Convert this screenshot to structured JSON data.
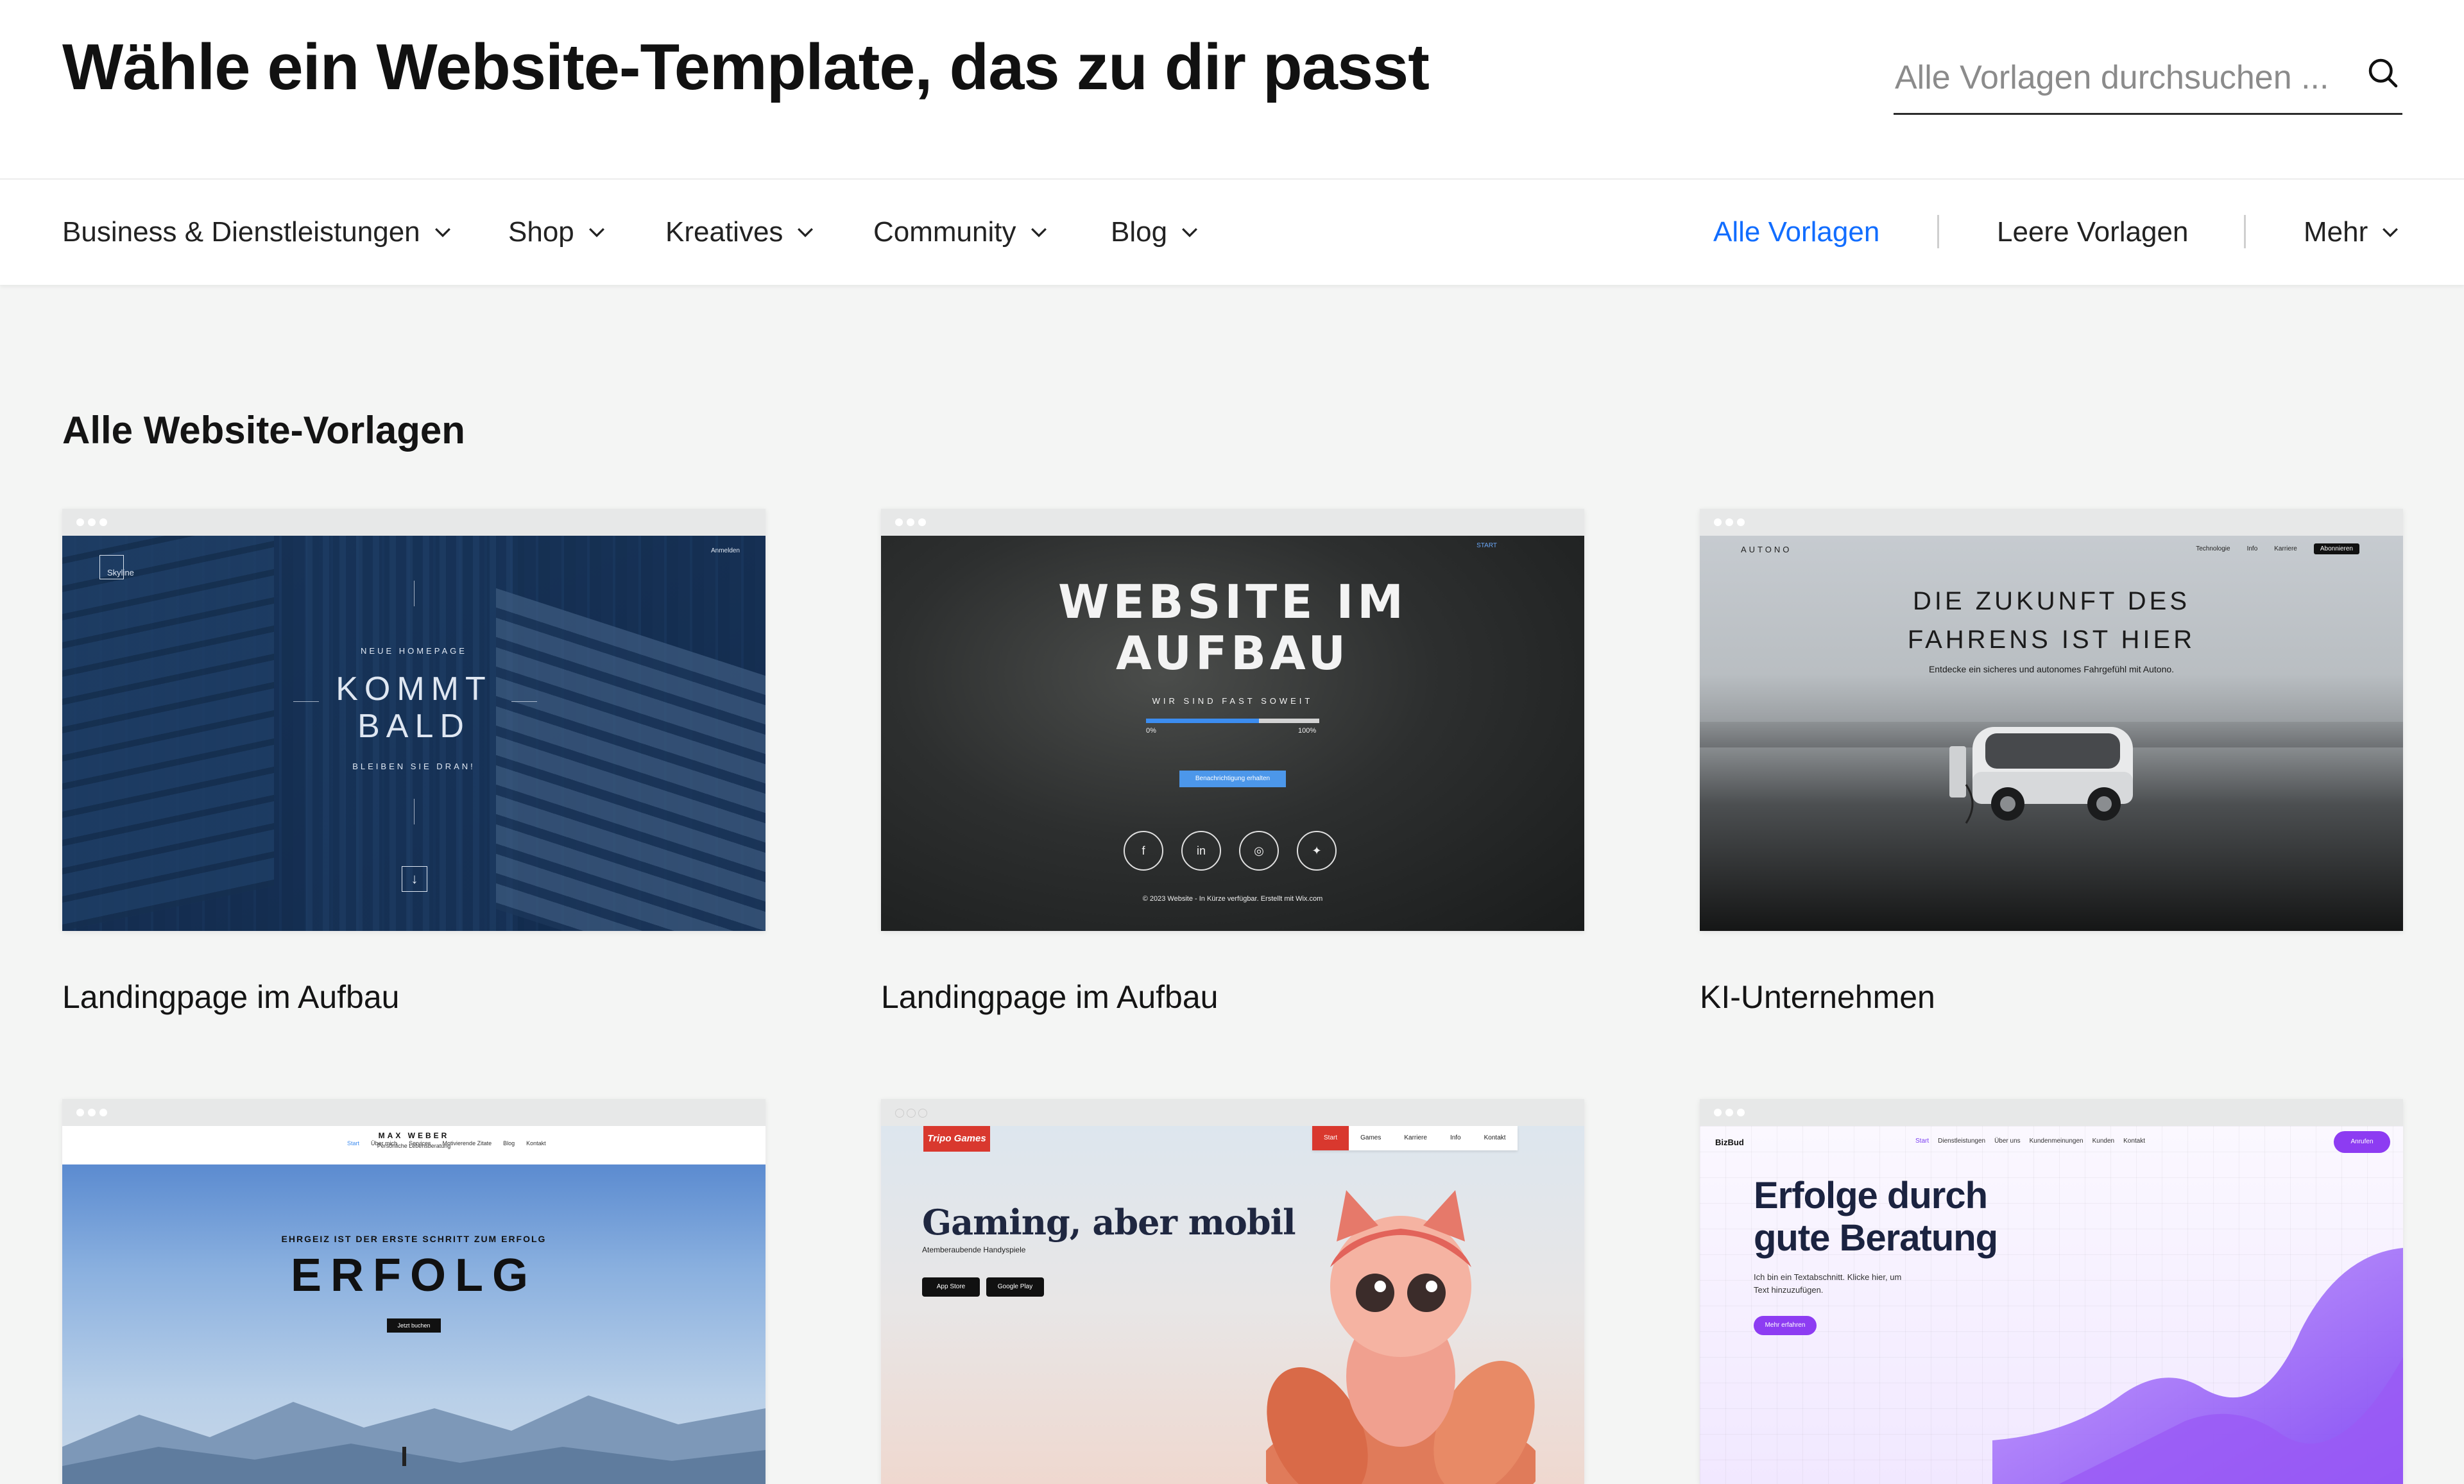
{
  "header": {
    "title": "Wähle ein Website-Template, das zu dir passt",
    "search_placeholder": "Alle Vorlagen durchsuchen ..."
  },
  "nav": {
    "categories": [
      {
        "label": "Business & Dienstleistungen"
      },
      {
        "label": "Shop"
      },
      {
        "label": "Kreatives"
      },
      {
        "label": "Community"
      },
      {
        "label": "Blog"
      }
    ],
    "all_templates": "Alle Vorlagen",
    "blank_templates": "Leere Vorlagen",
    "more": "Mehr",
    "accent_color": "#116dff"
  },
  "section": {
    "title": "Alle Website-Vorlagen"
  },
  "templates": [
    {
      "caption": "Landingpage im Aufbau",
      "preview": {
        "logo": "Skyline",
        "menu": "Anmelden",
        "pre": "NEUE HOMEPAGE",
        "headline1": "KOMMT",
        "headline2": "BALD",
        "sub": "BLEIBEN SIE DRAN!"
      }
    },
    {
      "caption": "Landingpage im Aufbau",
      "preview": {
        "start": "START",
        "headline1": "WEBSITE IM",
        "headline2": "AUFBAU",
        "sub": "WIR SIND FAST SOWEIT",
        "progress_start": "0%",
        "progress_end": "100%",
        "progress_value": 0.65,
        "button": "Benachrichtigung erhalten",
        "footer": "© 2023 Website - In Kürze verfügbar. Erstellt mit Wix.com"
      }
    },
    {
      "caption": "KI-Unternehmen",
      "preview": {
        "brand": "AUTONO",
        "nav": [
          "Technologie",
          "Info",
          "Karriere"
        ],
        "nav_cta": "Abonnieren",
        "headline1": "DIE ZUKUNFT DES",
        "headline2": "FAHRENS IST HIER",
        "sub": "Entdecke ein sicheres und autonomes Fahrgefühl mit Autono."
      }
    },
    {
      "caption": "",
      "preview": {
        "brand": "MAX WEBER",
        "brand_sub": "Persönliche Lebensberatung",
        "nav": [
          "Start",
          "Über mich",
          "Services",
          "Motivierende Zitate",
          "Blog",
          "Kontakt"
        ],
        "pre": "EHRGEIZ IST DER ERSTE SCHRITT ZUM ERFOLG",
        "headline": "ERFOLG",
        "button": "Jetzt buchen"
      }
    },
    {
      "caption": "",
      "preview": {
        "logo": "Tripo Games",
        "nav": [
          "Start",
          "Games",
          "Karriere",
          "Info",
          "Kontakt"
        ],
        "headline": "Gaming, aber mobil",
        "sub": "Atemberaubende Handyspiele",
        "store1": "App Store",
        "store2": "Google Play"
      }
    },
    {
      "caption": "",
      "preview": {
        "brand": "BizBud",
        "nav": [
          "Start",
          "Dienstleistungen",
          "Über uns",
          "Kundenmeinungen",
          "Kunden",
          "Kontakt"
        ],
        "cta": "Anrufen",
        "headline1": "Erfolge durch",
        "headline2": "gute Beratung",
        "text": "Ich bin ein Textabschnitt. Klicke hier, um Text hinzuzufügen.",
        "button": "Mehr erfahren"
      }
    }
  ]
}
